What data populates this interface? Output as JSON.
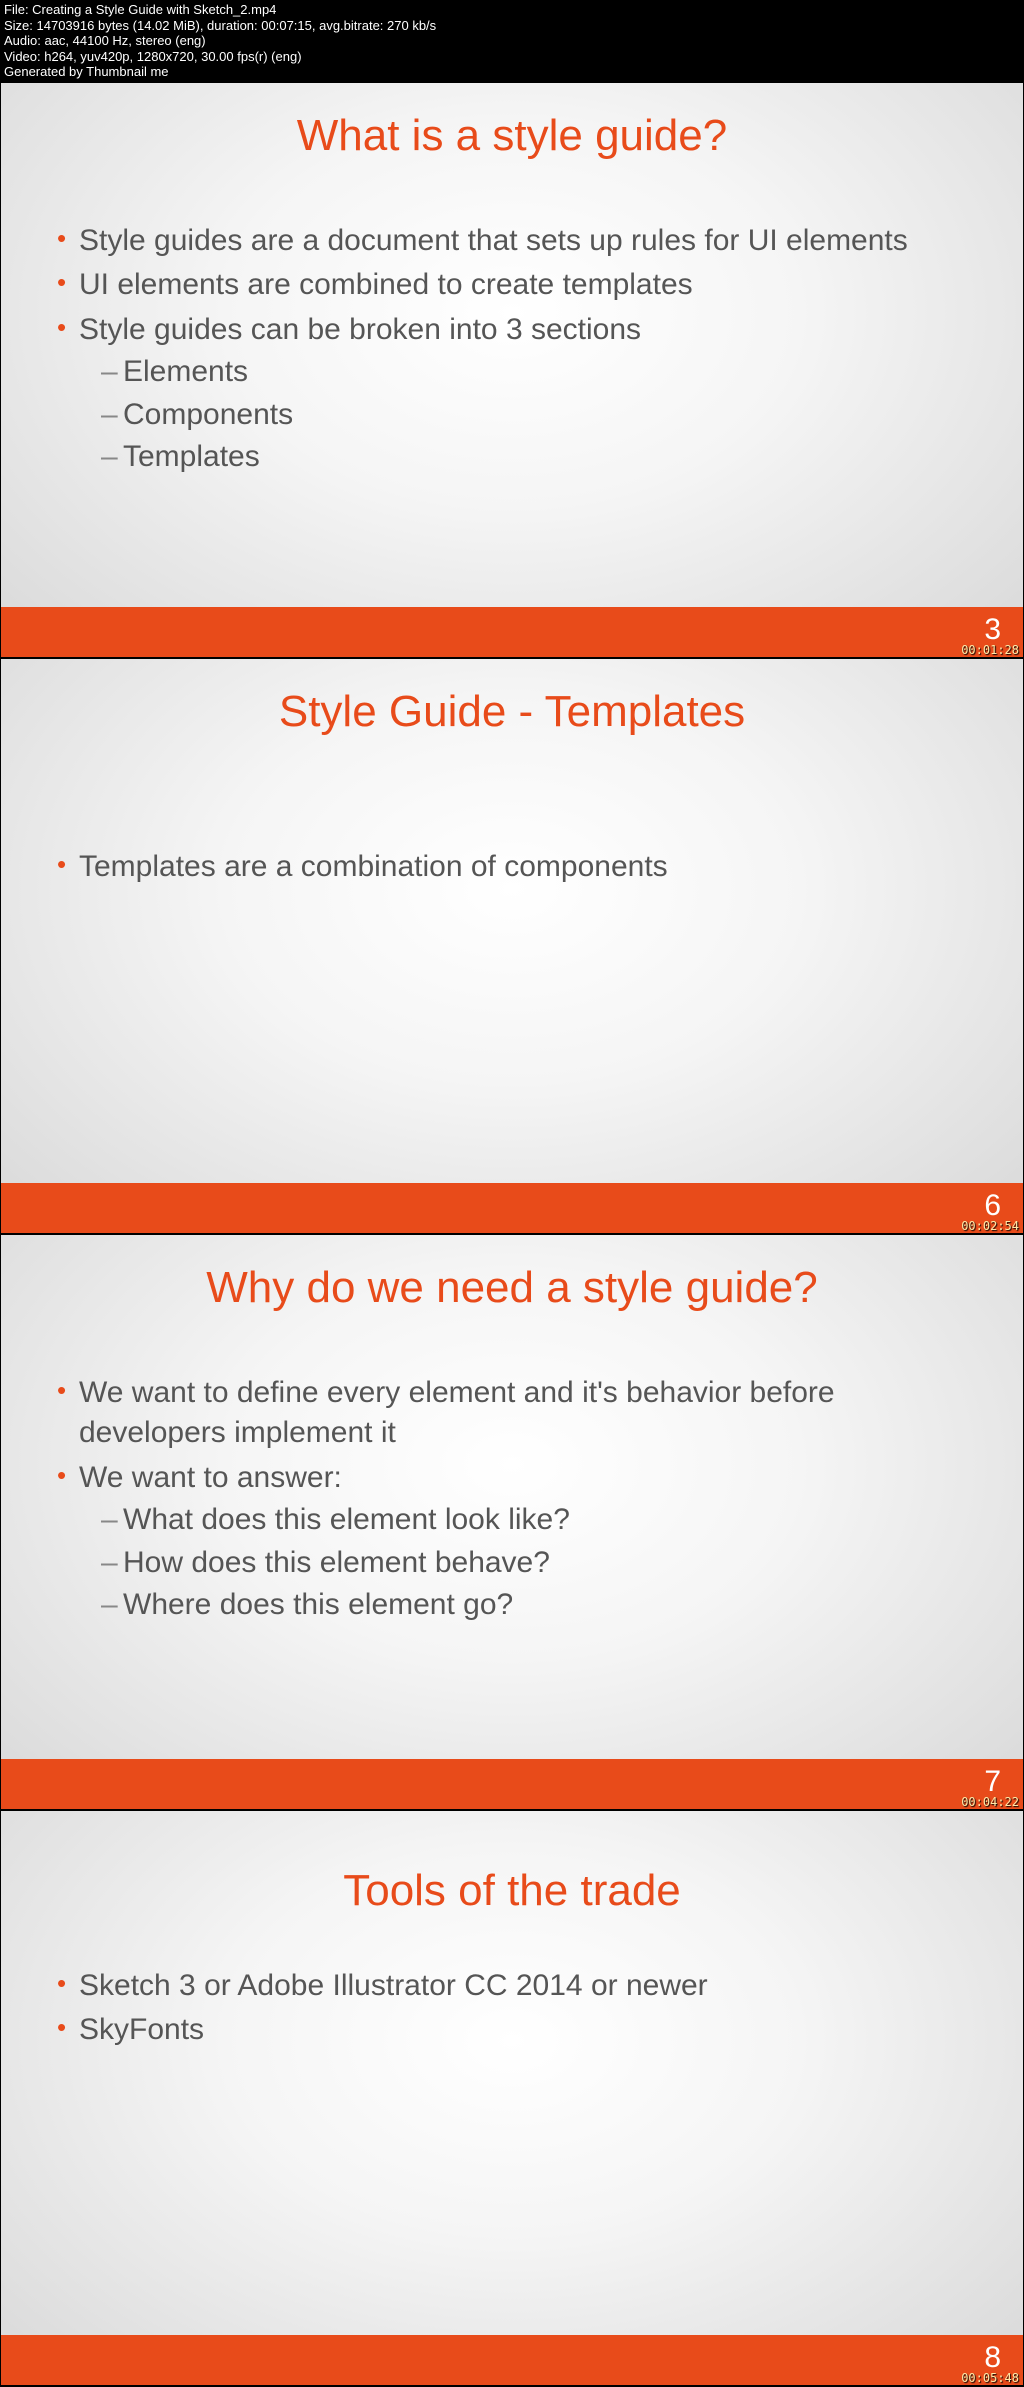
{
  "header": {
    "file": "File: Creating a Style Guide with Sketch_2.mp4",
    "size": "Size: 14703916 bytes (14.02 MiB), duration: 00:07:15, avg.bitrate: 270 kb/s",
    "audio": "Audio: aac, 44100 Hz, stereo (eng)",
    "video": "Video: h264, yuv420p, 1280x720, 30.00 fps(r) (eng)",
    "generated": "Generated by Thumbnail me"
  },
  "slides": [
    {
      "title": "What is a style guide?",
      "bullets": [
        "Style guides are a document that sets up rules for UI elements",
        "UI elements are combined to create templates",
        "Style guides can be broken into 3 sections"
      ],
      "subs": [
        "Elements",
        "Components",
        "Templates"
      ],
      "page": "3",
      "time": "00:01:28"
    },
    {
      "title": "Style Guide - Templates",
      "bullets": [
        "Templates are a combination of components"
      ],
      "page": "6",
      "time": "00:02:54"
    },
    {
      "title": "Why do we need a style guide?",
      "bullets": [
        "We want to define every element and it's behavior before developers implement it",
        "We want to answer:"
      ],
      "subs": [
        "What does this element look like?",
        "How does this element behave?",
        "Where does this element go?"
      ],
      "page": "7",
      "time": "00:04:22"
    },
    {
      "title": "Tools of the trade",
      "bullets": [
        "Sketch 3 or Adobe Illustrator CC 2014 or newer",
        "SkyFonts"
      ],
      "page": "8",
      "time": "00:05:48"
    }
  ]
}
